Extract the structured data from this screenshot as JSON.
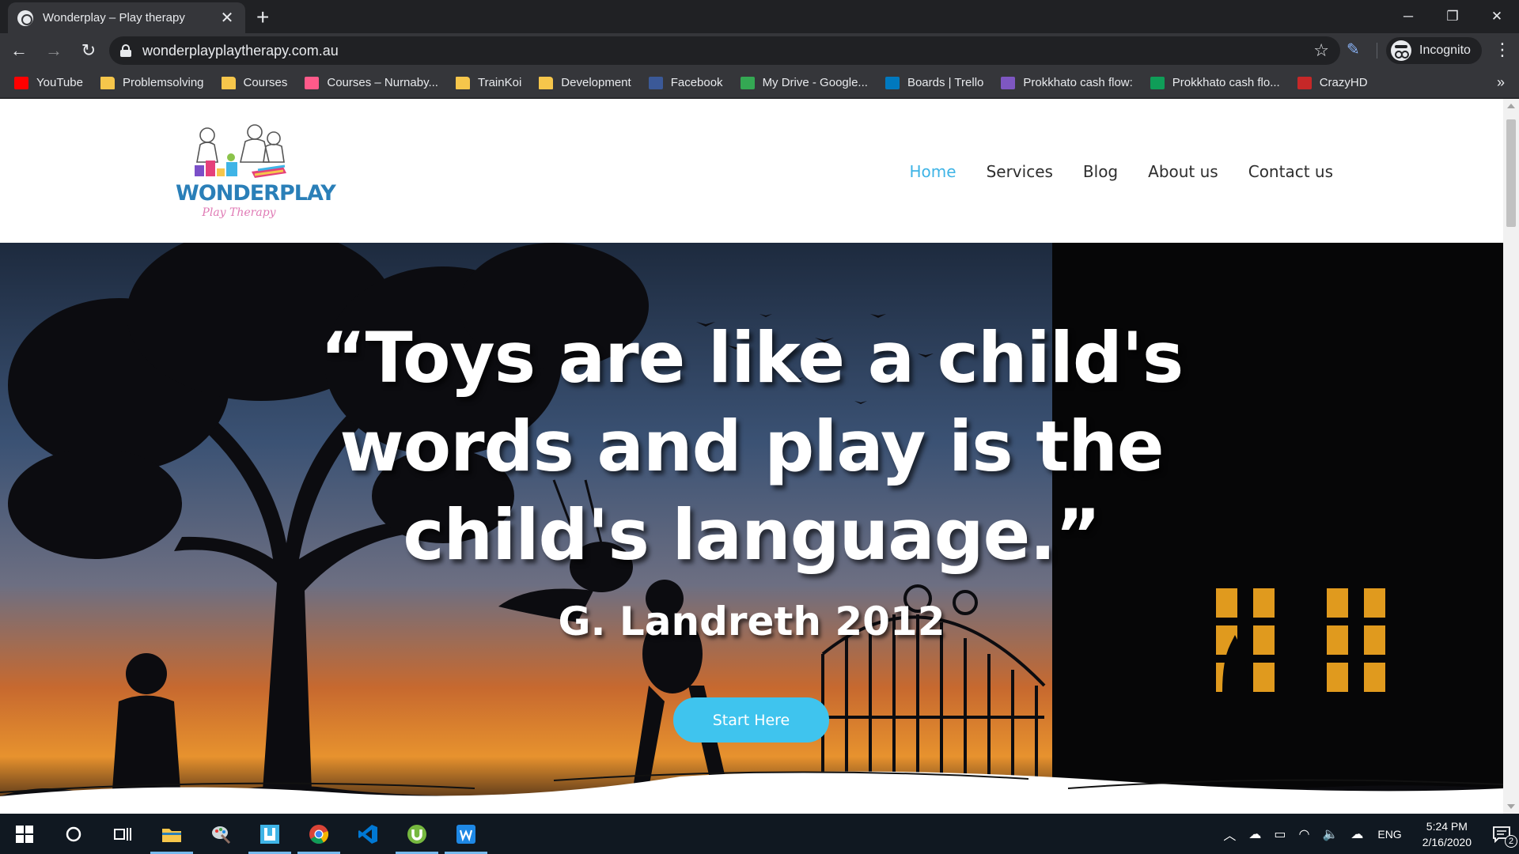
{
  "browser": {
    "tab": {
      "title": "Wonderplay – Play therapy",
      "close": "✕"
    },
    "new_tab": "+",
    "window": {
      "minimize": "─",
      "restore": "❐",
      "close": "✕"
    },
    "nav": {
      "back": "←",
      "forward": "→",
      "reload": "↻"
    },
    "url": "wonderplayplaytherapy.com.au",
    "star": "☆",
    "incognito_label": "Incognito",
    "menu": "⋮",
    "bookmarks": [
      {
        "label": "YouTube",
        "icon": "youtube-icon",
        "color": "#ff0000"
      },
      {
        "label": "Problemsolving",
        "icon": "folder-icon",
        "color": "#f6c64b"
      },
      {
        "label": "Courses",
        "icon": "folder-icon",
        "color": "#f6c64b"
      },
      {
        "label": "Courses – Nurnaby...",
        "icon": "app-icon",
        "color": "#ff5a8a"
      },
      {
        "label": "TrainKoi",
        "icon": "folder-icon",
        "color": "#f6c64b"
      },
      {
        "label": "Development",
        "icon": "folder-icon",
        "color": "#f6c64b"
      },
      {
        "label": "Facebook",
        "icon": "facebook-icon",
        "color": "#3b5998"
      },
      {
        "label": "My Drive - Google...",
        "icon": "drive-icon",
        "color": "#34a853"
      },
      {
        "label": "Boards | Trello",
        "icon": "trello-icon",
        "color": "#0079bf"
      },
      {
        "label": "Prokkhato cash flow:",
        "icon": "forms-icon",
        "color": "#7e57c2"
      },
      {
        "label": "Prokkhato cash flo...",
        "icon": "sheets-icon",
        "color": "#0f9d58"
      },
      {
        "label": "CrazyHD",
        "icon": "crazyhd-icon",
        "color": "#c62828"
      }
    ],
    "bookmarks_more": "»"
  },
  "site": {
    "logo_text": "WONDERPLAY",
    "logo_sub": "Play Therapy",
    "nav": [
      {
        "label": "Home",
        "active": true
      },
      {
        "label": "Services",
        "active": false
      },
      {
        "label": "Blog",
        "active": false
      },
      {
        "label": "About us",
        "active": false
      },
      {
        "label": "Contact us",
        "active": false
      }
    ],
    "hero": {
      "quote_lines": [
        "“Toys are like a child's",
        "words and play is the",
        "child's language.”"
      ],
      "author": "G. Landreth 2012",
      "cta": "Start Here"
    }
  },
  "taskbar": {
    "apps": [
      "windows-start-icon",
      "cortana-icon",
      "task-view-icon",
      "file-explorer-icon",
      "paint-icon",
      "app-icon",
      "chrome-icon",
      "vscode-icon",
      "utorrent-icon",
      "word-icon"
    ],
    "lang": "ENG",
    "time": "5:24 PM",
    "date": "2/16/2020",
    "notification_count": "2"
  },
  "colors": {
    "accent": "#3fc4ee",
    "nav_active": "#3fb4e6",
    "logo_blue": "#2a7fb8",
    "logo_pink": "#e07ab5"
  }
}
